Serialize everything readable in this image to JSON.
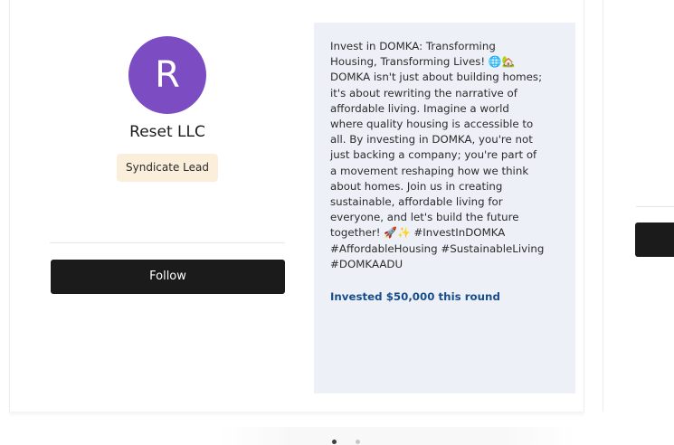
{
  "profile": {
    "avatar_initial": "R",
    "avatar_color": "#7b4cc2",
    "name": "Reset LLC",
    "role_badge": "Syndicate Lead",
    "follow_label": "Follow"
  },
  "investment": {
    "pitch": "Invest in DOMKA: Transforming\nHousing, Transforming Lives! 🌐🏡\nDOMKA isn't just about building homes;\nit's about rewriting the narrative of\naffordable living. Imagine a world\nwhere quality housing is accessible to\nall. By investing in DOMKA, you're not\njust backing a company; you're part of\na movement reshaping how we think\nabout homes. Join us in creating\nsustainable, affordable living for\neveryone, and let's build the future\ntogether! 🚀✨ #InvestInDOMKA\n#AffordableHousing #SustainableLiving\n#DOMKAADU",
    "invested_label": "Invested $50,000 this round",
    "invested_color": "#174d8a"
  },
  "carousel": {
    "pages": 2,
    "active_page": 1
  }
}
